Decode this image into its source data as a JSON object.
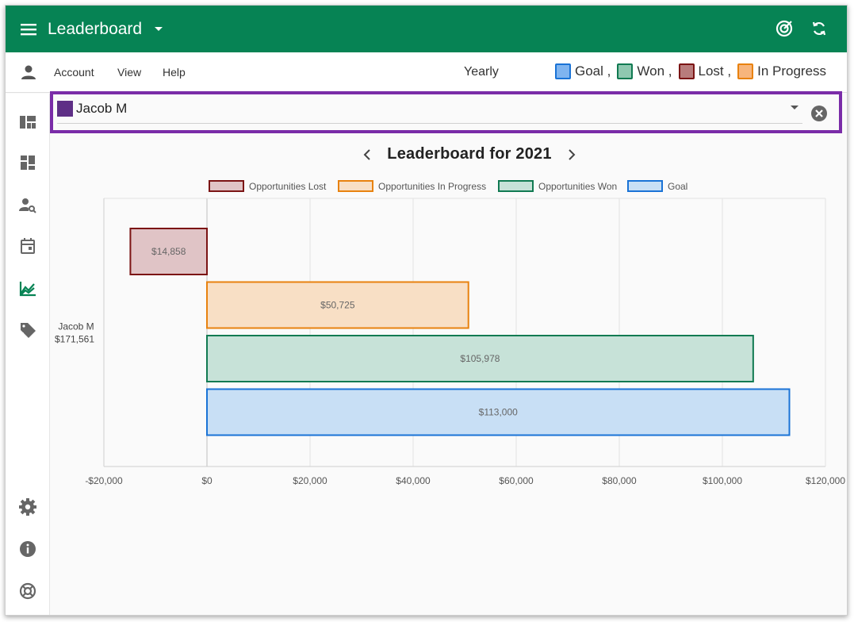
{
  "app": {
    "title": "Leaderboard"
  },
  "menu": {
    "account": "Account",
    "view": "View",
    "help": "Help",
    "period": "Yearly"
  },
  "legend_top": [
    {
      "label": "Goal",
      "sep": ",",
      "fill": "#7fb4f0",
      "stroke": "#1a73d6"
    },
    {
      "label": "Won",
      "sep": ",",
      "fill": "#8fc8b0",
      "stroke": "#117a52"
    },
    {
      "label": "Lost",
      "sep": ",",
      "fill": "#b87c7c",
      "stroke": "#7b1414"
    },
    {
      "label": "In Progress",
      "sep": "",
      "fill": "#f7b57c",
      "stroke": "#e8820f"
    }
  ],
  "filter": {
    "selected": "Jacob M",
    "color": "#5e2f86"
  },
  "chart_title": "Leaderboard for 2021",
  "chart_data": {
    "type": "bar",
    "orientation": "horizontal",
    "title": "Leaderboard for 2021",
    "categories": [
      "Jacob M"
    ],
    "category_labels": [
      {
        "name": "Jacob M",
        "total": "$171,561"
      }
    ],
    "series": [
      {
        "name": "Opportunities Lost",
        "values": [
          -14858
        ],
        "label": "$14,858",
        "fill": "#e0c4c6",
        "stroke": "#7b1414"
      },
      {
        "name": "Opportunities In Progress",
        "values": [
          50725
        ],
        "label": "$50,725",
        "fill": "#f8dfc5",
        "stroke": "#e8820f"
      },
      {
        "name": "Opportunities Won",
        "values": [
          105978
        ],
        "label": "$105,978",
        "fill": "#c7e2d8",
        "stroke": "#117a52"
      },
      {
        "name": "Goal",
        "values": [
          113000
        ],
        "label": "$113,000",
        "fill": "#c8dff5",
        "stroke": "#1a73d6"
      }
    ],
    "xlim": [
      -20000,
      120000
    ],
    "xticks": [
      -20000,
      0,
      20000,
      40000,
      60000,
      80000,
      100000,
      120000
    ],
    "xtick_labels": [
      "-$20,000",
      "$0",
      "$20,000",
      "$40,000",
      "$60,000",
      "$80,000",
      "$100,000",
      "$120,000"
    ],
    "grid": true,
    "legend_placement": "top-center"
  },
  "sidebar": [
    "dashboard-icon",
    "board-icon",
    "person-search-icon",
    "calendar-icon",
    "chart-icon",
    "tag-icon",
    "settings-icon",
    "info-icon",
    "help-icon"
  ]
}
